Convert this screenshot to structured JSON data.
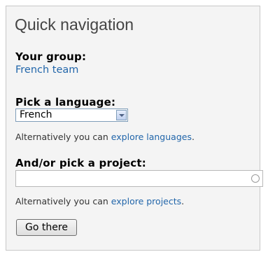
{
  "panel": {
    "title": "Quick navigation",
    "group": {
      "heading": "Your group:",
      "link": "French team"
    },
    "language": {
      "heading": "Pick a language:",
      "selected": "French",
      "hint_prefix": "Alternatively you can ",
      "hint_link": "explore languages",
      "hint_suffix": "."
    },
    "project": {
      "heading": "And/or pick a project:",
      "value": "",
      "hint_prefix": "Alternatively you can ",
      "hint_link": "explore projects",
      "hint_suffix": "."
    },
    "submit_label": "Go there"
  }
}
